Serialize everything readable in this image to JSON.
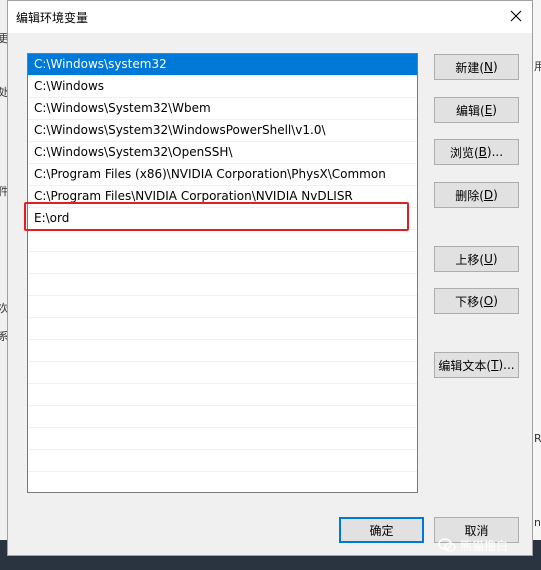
{
  "window": {
    "title": "编辑环境变量"
  },
  "paths": [
    "C:\\Windows\\system32",
    "C:\\Windows",
    "C:\\Windows\\System32\\Wbem",
    "C:\\Windows\\System32\\WindowsPowerShell\\v1.0\\",
    "C:\\Windows\\System32\\OpenSSH\\",
    "C:\\Program Files (x86)\\NVIDIA Corporation\\PhysX\\Common",
    "C:\\Program Files\\NVIDIA Corporation\\NVIDIA NvDLISR",
    "E:\\ord"
  ],
  "selected_index": 0,
  "buttons": {
    "new": {
      "text": "新建(",
      "key": "N",
      "end": ")"
    },
    "edit": {
      "text": "编辑(",
      "key": "E",
      "end": ")"
    },
    "browse": {
      "text": "浏览(",
      "key": "B",
      "end": ")..."
    },
    "delete": {
      "text": "删除(",
      "key": "D",
      "end": ")"
    },
    "move_up": {
      "text": "上移(",
      "key": "U",
      "end": ")"
    },
    "move_down": {
      "text": "下移(",
      "key": "O",
      "end": ")"
    },
    "edit_text": {
      "text": "编辑文本(",
      "key": "T",
      "end": ")..."
    },
    "ok": "确定",
    "cancel": "取消"
  },
  "background_fragments": {
    "left": [
      "更",
      "处",
      "件",
      "次",
      "系"
    ],
    "right": [
      "用",
      "R",
      "n"
    ]
  },
  "watermark": "熊猫撸白",
  "colors": {
    "selection": "#0078d7",
    "highlight_box": "#e02020"
  }
}
